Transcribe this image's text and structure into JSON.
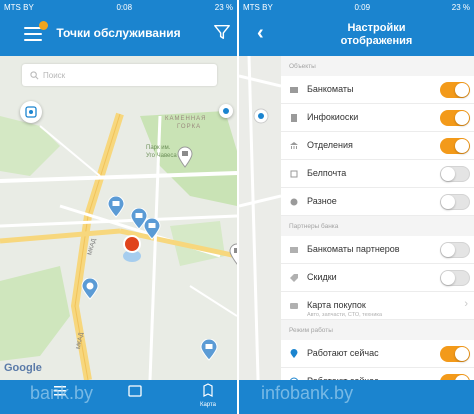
{
  "left": {
    "status": {
      "carrier": "MTS BY",
      "time": "0:08",
      "battery": "23 %"
    },
    "header": {
      "title": "Точки обслуживания"
    },
    "search": {
      "placeholder": "Поиск"
    },
    "map": {
      "labels": [
        "КАМЕННАЯ",
        "ГОРКА",
        "Парк им.",
        "Уго Чавеса",
        "МКАД",
        "МКАД"
      ],
      "google": "Google"
    },
    "tabs": [
      {
        "name": "list"
      },
      {
        "name": "layers"
      },
      {
        "name": "map",
        "label": "Карта"
      }
    ],
    "watermark": "bank.by"
  },
  "right": {
    "status": {
      "carrier": "MTS BY",
      "time": "0:09",
      "battery": "23 %"
    },
    "header": {
      "title_line1": "Настройки",
      "title_line2": "отображения"
    },
    "sections": [
      {
        "title": "Объекты",
        "rows": [
          {
            "label": "Банкоматы",
            "toggle": "on",
            "icon": "atm-icon"
          },
          {
            "label": "Инфокиоски",
            "toggle": "on",
            "icon": "kiosk-icon"
          },
          {
            "label": "Отделения",
            "toggle": "on",
            "icon": "bank-icon"
          },
          {
            "label": "Белпочта",
            "toggle": "off",
            "icon": "post-icon"
          },
          {
            "label": "Разное",
            "toggle": "off",
            "icon": "misc-icon"
          }
        ]
      },
      {
        "title": "Партнеры банка",
        "rows": [
          {
            "label": "Банкоматы партнеров",
            "toggle": "off",
            "icon": "partner-atm-icon"
          },
          {
            "label": "Скидки",
            "toggle": "off",
            "icon": "discount-icon"
          },
          {
            "label": "Карта покупок",
            "subtitle": "Авто, запчасти, СТО, техника",
            "icon": "card-icon",
            "chevron": true
          }
        ]
      },
      {
        "title": "Режим работы",
        "rows": [
          {
            "label": "Работают сейчас",
            "toggle": "on",
            "icon": "pin-icon"
          },
          {
            "label": "Работают сейчас",
            "toggle": "on",
            "icon": "clock-icon"
          }
        ]
      }
    ],
    "watermark": "infobank.by"
  },
  "colors": {
    "primary": "#1b84cf",
    "accent": "#f39a1a",
    "pin": "#5b9bd5",
    "user": "#e0441c"
  }
}
